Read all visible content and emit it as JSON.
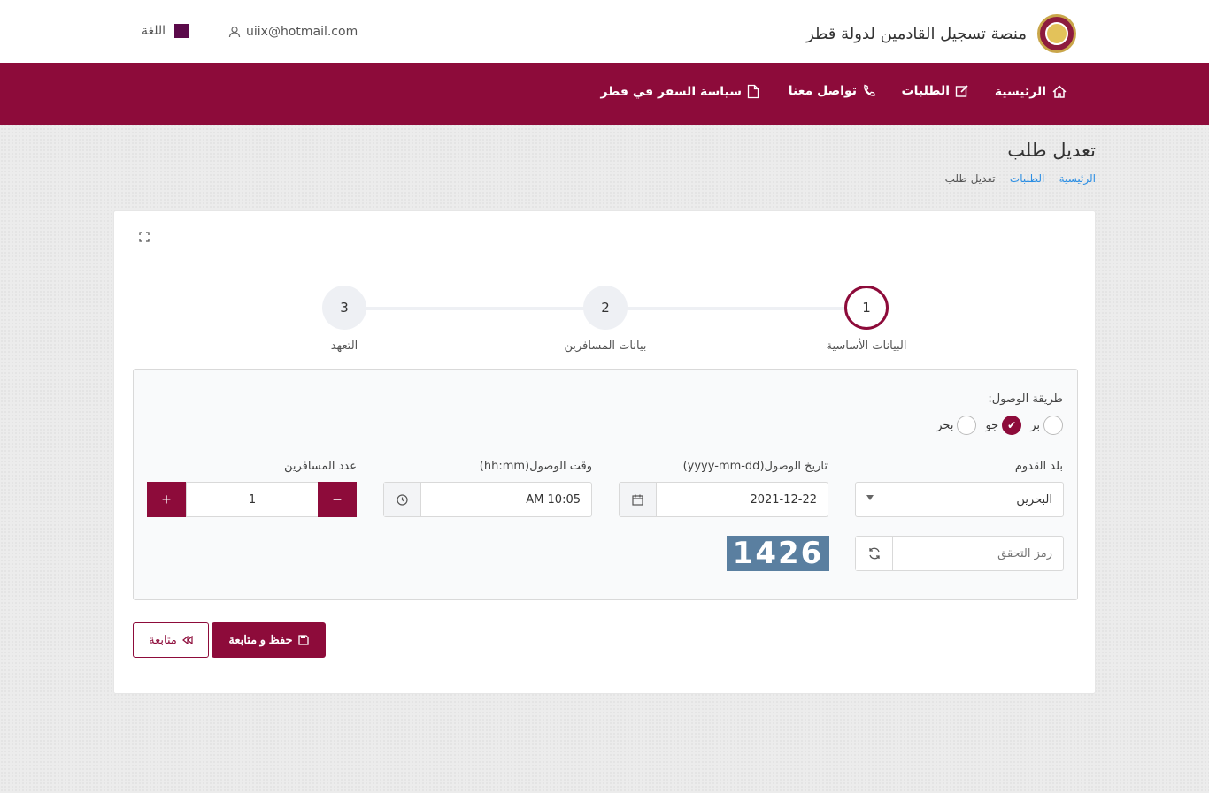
{
  "header": {
    "title": "منصة تسجيل القادمين لدولة قطر",
    "user_email": "uiix@hotmail.com",
    "language_label": "اللغة"
  },
  "nav": {
    "home": "الرئيسية",
    "requests": "الطلبات",
    "contact": "تواصل معنا",
    "travel_policy": "سياسة السفر في قطر"
  },
  "page": {
    "title": "تعديل طلب",
    "breadcrumb": [
      "الرئيسية",
      "الطلبات",
      "تعديل طلب"
    ],
    "breadcrumb_sep": "-"
  },
  "steps": [
    {
      "number": "1",
      "label": "البيانات الأساسية",
      "active": true
    },
    {
      "number": "2",
      "label": "بيانات المسافرين",
      "active": false
    },
    {
      "number": "3",
      "label": "التعهد",
      "active": false
    }
  ],
  "form": {
    "arrival_method_label": "طريقة الوصول:",
    "arrival_methods": [
      {
        "label": "بر",
        "checked": false
      },
      {
        "label": "جو",
        "checked": true
      },
      {
        "label": "بحر",
        "checked": false
      }
    ],
    "country_label": "بلد القدوم",
    "country_value": "البحرين",
    "date_label": "تاريخ الوصول(yyyy-mm-dd)",
    "date_value": "2021-12-22",
    "time_label": "وقت الوصول(hh:mm)",
    "time_value": "10:05 AM",
    "travelers_label": "عدد المسافرين",
    "travelers_value": "1",
    "minus": "−",
    "plus": "+",
    "captcha_placeholder": "رمز التحقق",
    "captcha_value": "1426"
  },
  "actions": {
    "save_continue": "حفظ و متابعة",
    "continue": "متابعة"
  },
  "colors": {
    "brand": "#8d0b3a",
    "captcha_bg": "#5a7fa0"
  }
}
